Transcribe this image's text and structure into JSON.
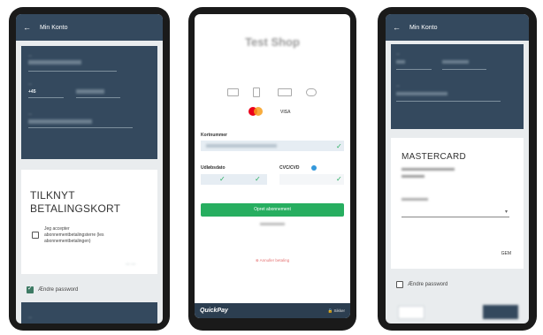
{
  "screen1": {
    "appbar_title": "Min Konto",
    "heading_line1": "TILKNYT",
    "heading_line2": "BETALINGSKORT",
    "consent_line1": "Jeg accepter",
    "consent_line2": "abonnementbetalingsterre (les",
    "consent_line3": "abonnementbetalingen)",
    "change_password": "Ændre password"
  },
  "screen2": {
    "shop_title": "Test Shop",
    "card_number_label": "Kortnummer",
    "expiry_label": "Udløbsdato",
    "cvc_label": "CVC/CVD",
    "pay_button": "Opret abonnement",
    "cancel_link": "Annuller betaling",
    "brand": "QuickPay",
    "footer_right": "Sikker"
  },
  "screen3": {
    "appbar_title": "Min Konto",
    "card_brand": "MASTERCARD",
    "save_label": "GEM",
    "change_password": "Ændre password"
  }
}
